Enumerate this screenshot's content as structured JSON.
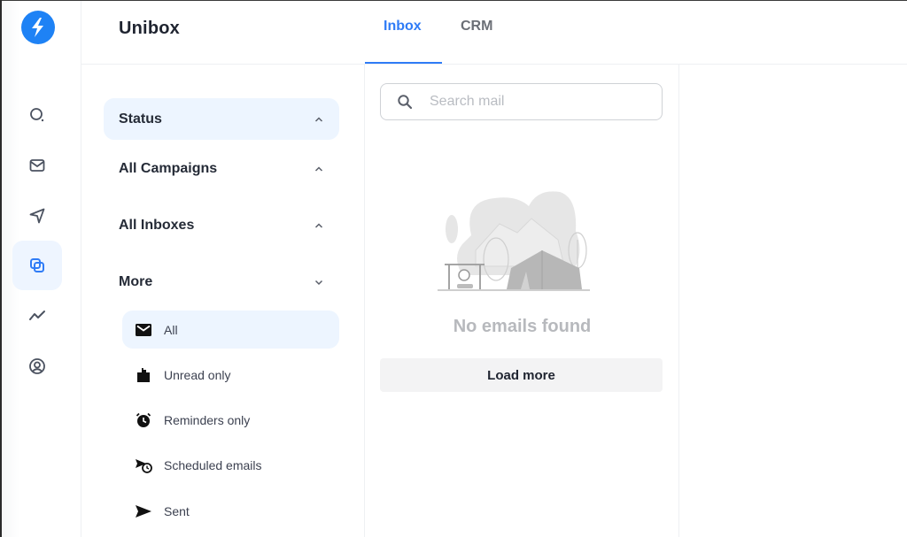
{
  "app": {
    "title": "Unibox",
    "brand_color": "#1e82f5",
    "accent_color": "#2f7cf6"
  },
  "rail": {
    "logo": "lightning-bolt-icon",
    "items": [
      {
        "name": "search",
        "icon": "search-icon",
        "active": false
      },
      {
        "name": "mail",
        "icon": "mail-icon",
        "active": false
      },
      {
        "name": "send",
        "icon": "send-icon",
        "active": false
      },
      {
        "name": "unibox",
        "icon": "copy-stack-icon",
        "active": true
      },
      {
        "name": "analytics",
        "icon": "trend-line-icon",
        "active": false
      },
      {
        "name": "account",
        "icon": "user-circle-icon",
        "active": false
      }
    ]
  },
  "tabs": [
    {
      "label": "Inbox",
      "active": true
    },
    {
      "label": "CRM",
      "active": false
    }
  ],
  "filters": {
    "groups": [
      {
        "label": "Status",
        "expanded": true,
        "active": true
      },
      {
        "label": "All Campaigns",
        "expanded": true,
        "active": false
      },
      {
        "label": "All Inboxes",
        "expanded": true,
        "active": false
      },
      {
        "label": "More",
        "expanded": false,
        "active": false
      }
    ],
    "more_items": [
      {
        "label": "All",
        "icon": "envelope-icon",
        "active": true
      },
      {
        "label": "Unread only",
        "icon": "unread-mailbox-icon",
        "active": false
      },
      {
        "label": "Reminders only",
        "icon": "alarm-clock-icon",
        "active": false
      },
      {
        "label": "Scheduled emails",
        "icon": "scheduled-send-icon",
        "active": false
      },
      {
        "label": "Sent",
        "icon": "sent-arrow-icon",
        "active": false
      }
    ]
  },
  "mail_list": {
    "search": {
      "placeholder": "Search mail",
      "value": ""
    },
    "empty_message": "No emails found",
    "load_more_label": "Load more"
  }
}
